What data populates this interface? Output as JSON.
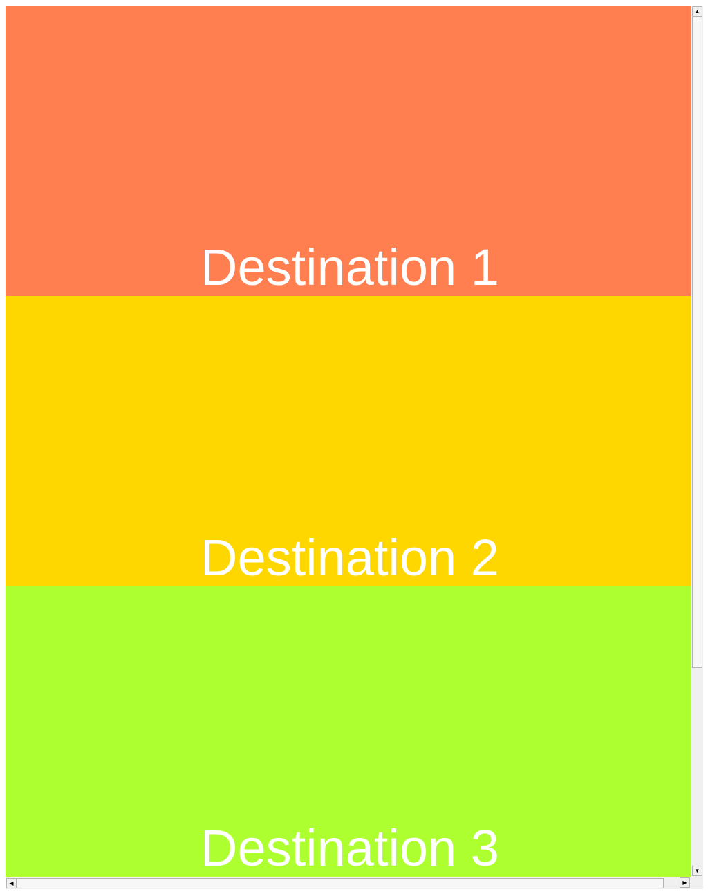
{
  "panels": [
    {
      "label": "Destination 1",
      "color": "#ff7f50"
    },
    {
      "label": "Destination 2",
      "color": "#ffd700"
    },
    {
      "label": "Destination 3",
      "color": "#adff2f"
    }
  ],
  "scrollbars": {
    "up_icon": "triangle-up-icon",
    "down_icon": "triangle-down-icon",
    "left_icon": "triangle-left-icon",
    "right_icon": "triangle-right-icon"
  }
}
